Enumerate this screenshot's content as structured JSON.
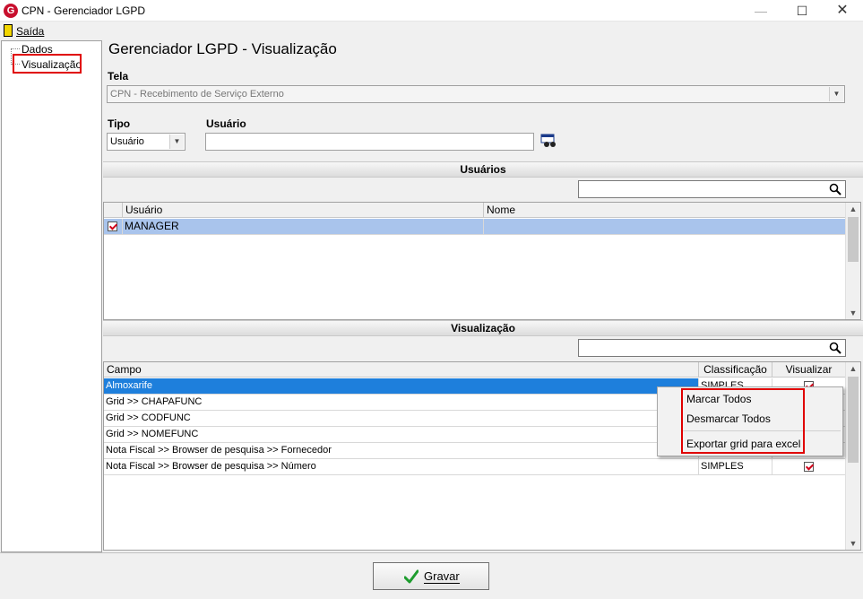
{
  "window": {
    "title": "CPN - Gerenciador LGPD",
    "app_icon_letter": "G",
    "min_label": "—",
    "max_label": "☐",
    "close_label": "✕"
  },
  "menubar": {
    "saida": "Saída"
  },
  "sidebar": {
    "items": [
      {
        "label": "Dados"
      },
      {
        "label": "Visualização"
      }
    ]
  },
  "main": {
    "page_title": "Gerenciador LGPD - Visualização",
    "tela": {
      "label": "Tela",
      "value": "CPN - Recebimento de Serviço Externo"
    },
    "tipo": {
      "label": "Tipo",
      "value": "Usuário"
    },
    "usuario": {
      "label": "Usuário",
      "value": ""
    }
  },
  "usuarios_section": {
    "title": "Usuários",
    "search_value": "",
    "columns": [
      "Usuário",
      "Nome"
    ],
    "rows": [
      {
        "checked": true,
        "usuario": "MANAGER",
        "nome": ""
      }
    ]
  },
  "visualizacao_section": {
    "title": "Visualização",
    "search_value": "",
    "columns": [
      "Campo",
      "Classificação",
      "Visualizar"
    ],
    "rows": [
      {
        "campo": "Almoxarife",
        "classificacao": "SIMPLES",
        "visualizar": true
      },
      {
        "campo": "Grid >> CHAPAFUNC",
        "classificacao": "",
        "visualizar": true
      },
      {
        "campo": "Grid >> CODFUNC",
        "classificacao": "",
        "visualizar": true
      },
      {
        "campo": "Grid >> NOMEFUNC",
        "classificacao": "",
        "visualizar": true
      },
      {
        "campo": "Nota Fiscal >> Browser de pesquisa >> Fornecedor",
        "classificacao": "",
        "visualizar": true
      },
      {
        "campo": "Nota Fiscal >> Browser de pesquisa >> Número",
        "classificacao": "SIMPLES",
        "visualizar": true
      }
    ]
  },
  "context_menu": {
    "items": [
      "Marcar Todos",
      "Desmarcar Todos",
      "Exportar grid para excel"
    ]
  },
  "footer": {
    "gravar_label": "Gravar"
  },
  "colors": {
    "selected_row": "#a9c4ec",
    "highlight_row": "#1e7fdc",
    "annotation_red": "#e00000"
  }
}
